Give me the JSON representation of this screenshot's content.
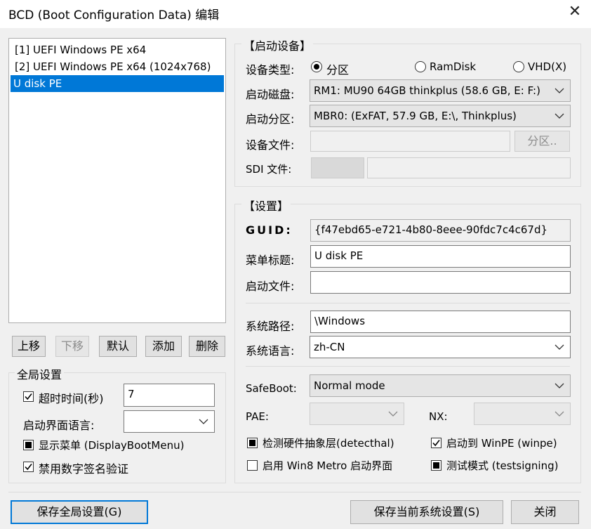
{
  "window": {
    "title": "BCD (Boot Configuration Data) 编辑",
    "close": "✕"
  },
  "entries": [
    "[1] UEFI Windows PE x64",
    "[2] UEFI Windows PE x64 (1024x768)",
    "U disk PE"
  ],
  "list_buttons": {
    "up": "上移",
    "down": "下移",
    "default": "默认",
    "add": "添加",
    "delete": "删除"
  },
  "global": {
    "title": "全局设置",
    "timeout_label": "超时时间(秒)",
    "timeout_value": "7",
    "boot_lang_label": "启动界面语言:",
    "boot_lang_value": "",
    "display_menu": "显示菜单 (DisplayBootMenu)",
    "disable_sig": "禁用数字签名验证"
  },
  "device": {
    "title": "【启动设备】",
    "type_label": "设备类型:",
    "type_partition": "分区",
    "type_ramdisk": "RamDisk",
    "type_vhd": "VHD(X)",
    "disk_label": "启动磁盘:",
    "disk_value": "RM1: MU90 64GB thinkplus (58.6 GB, E: F:)",
    "partition_label": "启动分区:",
    "partition_value": "MBR0: (ExFAT,  57.9 GB, E:\\, Thinkplus)",
    "file_label": "设备文件:",
    "file_value": "",
    "partition_button": "分区..",
    "sdi_label": "SDI 文件:",
    "sdi_value": ""
  },
  "settings": {
    "title": "【设置】",
    "guid_label": "GUID:",
    "guid_value": "{f47ebd65-e721-4b80-8eee-90fdc7c4c67d}",
    "menu_title_label": "菜单标题:",
    "menu_title_value": "U disk PE",
    "boot_file_label": "启动文件:",
    "boot_file_value": "",
    "sys_path_label": "系统路径:",
    "sys_path_value": "\\Windows",
    "sys_lang_label": "系统语言:",
    "sys_lang_value": "zh-CN",
    "safeboot_label": "SafeBoot:",
    "safeboot_value": "Normal mode",
    "pae_label": "PAE:",
    "pae_value": "",
    "nx_label": "NX:",
    "nx_value": "",
    "detecthal": "检测硬件抽象层(detecthal)",
    "winpe": "启动到 WinPE (winpe)",
    "metro": "启用 Win8 Metro 启动界面",
    "testsigning": "测试模式 (testsigning)"
  },
  "footer": {
    "save_global": "保存全局设置(G)",
    "save_current": "保存当前系统设置(S)",
    "close": "关闭"
  },
  "colors": {
    "accent": "#0078d7",
    "background": "#f0f0f0"
  }
}
